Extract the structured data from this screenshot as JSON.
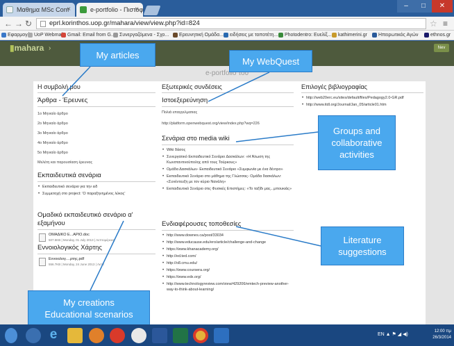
{
  "browser": {
    "tabs": [
      {
        "label": "Μαθημα MSc Com"
      },
      {
        "label": "e-portfolio - Πιστοφόρμα"
      }
    ],
    "url": "eprl.korinthos.uop.gr/mahara/view/view.php?id=824",
    "bookmarks": [
      {
        "label": "Εφαρμογές"
      },
      {
        "label": "UoP Webmail"
      },
      {
        "label": "Gmail: Email from G..."
      },
      {
        "label": "Συνεργαζόμενα - Σχο..."
      },
      {
        "label": "Ερευνητική Ομάδα..."
      },
      {
        "label": "ειδήσεις με τοποτέτη..."
      },
      {
        "label": "Photodentro: Ευελίξ..."
      },
      {
        "label": "kathimerini.gr"
      },
      {
        "label": "Ηπειρωτικός Αγών"
      },
      {
        "label": "ethnos.gr"
      }
    ]
  },
  "mahara": {
    "logo": "mahara",
    "page_title": "e-portfolio του",
    "header_button": "Nev"
  },
  "col1": {
    "heading": "Η συμβολή μου",
    "articles_heading": "Άρθρα - Έρευνες",
    "articles": [
      "1ο Μηνιαίο άρθρο",
      "2ο Μηνιαίο άρθρο",
      "3ο Μηνιαίο άρθρο",
      "4ο Μηνιαίο άρθρο",
      "5ο Μηνιαίο άρθρο",
      "Μελέτη και παρουσίαση έρευνας"
    ],
    "scenarios_heading": "Εκπαιδευτικά σενάρια",
    "scenarios": [
      "Εκπαιδευτικό σενάριο για την ειδ",
      "Συμμετοχή στο project: 'Ο παραξηνημένος λύκος'"
    ],
    "group_heading": "Ομαδικό εκπαιδευτικό σενάριο α' εξαμήνου",
    "group_file": {
      "name": "ΟΜΑΔΙΚΟ Ε...ΑΡΙΟ.doc",
      "meta": "507.5KB | Monday, 01 July 2013 | Λεπτομέρειες"
    },
    "concept_heading": "Εννοιολογικός Χάρτης",
    "concept_file": {
      "name": "Εννοιολογ....ρτης.pdf",
      "meta": "556.7KB | Monday, 24 June 2013 | Λεπτ"
    }
  },
  "col2": {
    "links_heading": "Εξωτερικές συνδέσεις",
    "webquest_heading": "Ιστοεξερεύνηση",
    "webquest_sub": "Πολιά επαγγελματιας",
    "webquest_url": "http://platform.openwebquest.org/view/index.php?wq=226",
    "wiki_heading": "Σενάρια στο media wiki",
    "wiki_items": [
      "Wiki δάσος",
      "Συνεργατικό Εκπαιδευτικό Σενάριο Δασκάλων: «Η Άλωση της Κωνσταντινούπολης από τους Τούρκους»",
      "Ομάδα Δασκάλων- Εκπαιδευτικό Σενάριο «Συμφωνία με ένα δέντρο»",
      "Εκπαιδευτικό Σενάριο στο μάθημα της Γλώσσας- Ομάδα δασκάλων: «Συνέντευξη με τον κύριο Νανάλη»",
      "Εκπαιδευτικό Σενάριο στις Φυσικές Επιστήμες: «Το ταξίδι μας...μπουκιάς»"
    ],
    "places_heading": "Ενδιαφέρουσες τοποθεσίες",
    "places": [
      "http://www.downes.ca/post/33034",
      "http://www.educause.edu/ero/article/challenge-and-change",
      "https://www.khanacademy.org/",
      "http://ed.ted.com/",
      "http://o8.cmu.edu/",
      "https://www.coursera.org/",
      "https://www.edx.org/",
      "http://www.technologyreview.com/view/429206/emtech-preview-another-way-to-think-about-learning/"
    ]
  },
  "col3": {
    "heading": "Επιλογές βιβλιογραφίας",
    "items": [
      "http://web20erc.eu/sites/default/files/Pedagogy2.0-GR.pdf",
      "http://www.itdl.org/Journal/Jan_05/article01.htm"
    ]
  },
  "callouts": {
    "articles": "My articles",
    "webquest": "My WebQuest",
    "groups_l1": "Groups and",
    "groups_l2": "collaborative",
    "groups_l3": "activities",
    "literature_l1": "Literature",
    "literature_l2": "suggestions",
    "creations_l1": "My creations",
    "creations_l2": "Educational scenarios"
  },
  "taskbar": {
    "tray": "EN",
    "time": "12:00 πμ",
    "date": "26/3/2014"
  },
  "colors": {
    "callout_fill": "#4aa8ee",
    "mahara_header": "#4e5a3d",
    "taskbar": "#1a4780"
  }
}
